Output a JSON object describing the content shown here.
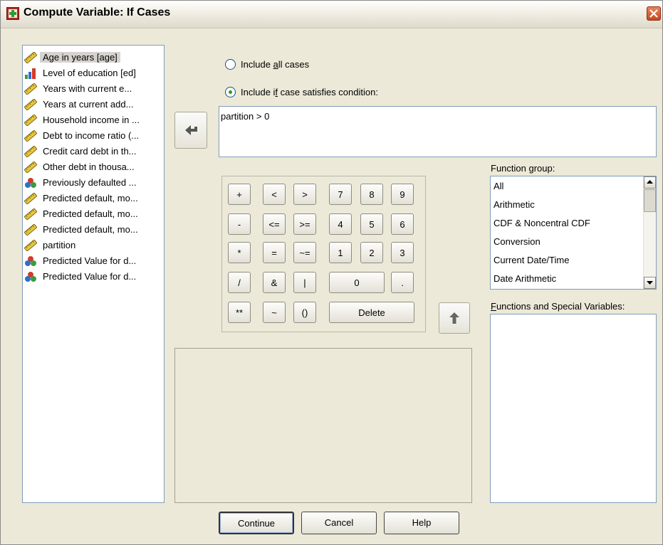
{
  "window": {
    "title": "Compute Variable: If Cases"
  },
  "variables": [
    {
      "label": "Age in years [age]",
      "icon": "ruler-scale-icon"
    },
    {
      "label": "Level of education [ed]",
      "icon": "bar-ordinal-icon"
    },
    {
      "label": "Years with current e...",
      "icon": "ruler-scale-icon"
    },
    {
      "label": "Years at current add...",
      "icon": "ruler-scale-icon"
    },
    {
      "label": "Household income in ...",
      "icon": "ruler-scale-icon"
    },
    {
      "label": "Debt to income ratio (...",
      "icon": "ruler-scale-icon"
    },
    {
      "label": "Credit card debt in th...",
      "icon": "ruler-scale-icon"
    },
    {
      "label": "Other debt in thousa...",
      "icon": "ruler-scale-icon"
    },
    {
      "label": "Previously defaulted ...",
      "icon": "nominal-balls-icon"
    },
    {
      "label": "Predicted default, mo...",
      "icon": "ruler-scale-icon"
    },
    {
      "label": "Predicted default, mo...",
      "icon": "ruler-scale-icon"
    },
    {
      "label": "Predicted default, mo...",
      "icon": "ruler-scale-icon"
    },
    {
      "label": "partition",
      "icon": "ruler-scale-icon"
    },
    {
      "label": "Predicted Value for d...",
      "icon": "nominal-balls-icon"
    },
    {
      "label": "Predicted Value for d...",
      "icon": "nominal-balls-icon"
    }
  ],
  "options": {
    "all_cases_pre": "Include ",
    "all_cases_u": "a",
    "all_cases_post": "ll cases",
    "if_case_pre": "Include i",
    "if_case_u": "f",
    "if_case_post": " case satisfies condition:",
    "selected": "if_case"
  },
  "condition": {
    "expression": "partition > 0"
  },
  "keypad": {
    "plus": "+",
    "lt": "<",
    "gt": ">",
    "k7": "7",
    "k8": "8",
    "k9": "9",
    "minus": "-",
    "le": "<=",
    "ge": ">=",
    "k4": "4",
    "k5": "5",
    "k6": "6",
    "mult": "*",
    "eq": "=",
    "ne": "~=",
    "k1": "1",
    "k2": "2",
    "k3": "3",
    "div": "/",
    "and": "&",
    "or": "|",
    "k0": "0",
    "dot": ".",
    "pow": "**",
    "not": "~",
    "paren": "()",
    "delete": "Delete"
  },
  "function_group": {
    "label_pre": "Function ",
    "label_u": "g",
    "label_post": "roup:",
    "items": [
      "All",
      "Arithmetic",
      "CDF & Noncentral CDF",
      "Conversion",
      "Current Date/Time",
      "Date Arithmetic"
    ]
  },
  "functions_special": {
    "label_u": "F",
    "label_post": "unctions and Special Variables:"
  },
  "buttons": {
    "continue": "Continue",
    "cancel": "Cancel",
    "help": "Help"
  },
  "colors": {
    "accent": "#21a121",
    "list_border": "#7f9db9",
    "dialog_bg": "#ece9d8"
  }
}
